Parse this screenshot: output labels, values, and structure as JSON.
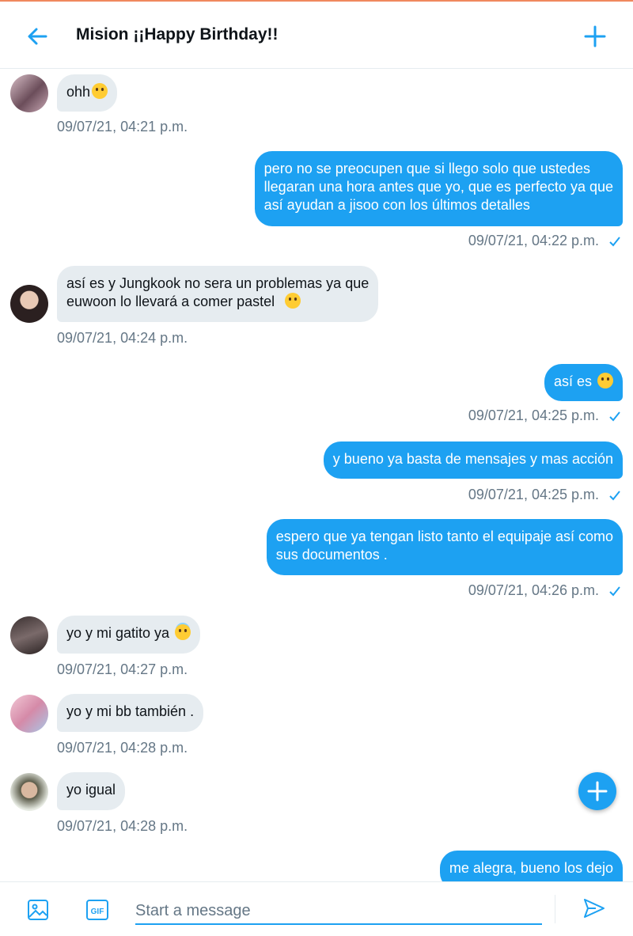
{
  "header": {
    "title": "Mision ¡¡Happy Birthday!!",
    "back_icon": "back-arrow-icon",
    "add_icon": "plus-icon"
  },
  "colors": {
    "accent": "#1da1f2",
    "incoming_bubble": "#e6ecf0",
    "timestamp": "#657786"
  },
  "messages": [
    {
      "id": 0,
      "direction": "in",
      "text": "ohh",
      "emoji": "face-emoji",
      "timestamp": "09/07/21, 04:21 p.m."
    },
    {
      "id": 1,
      "direction": "out",
      "lines": [
        "pero no se preocupen que si llego solo que ustedes",
        "llegaran una hora antes que yo, que es perfecto ya que",
        "así ayudan a jisoo con los últimos detalles"
      ],
      "timestamp": "09/07/21, 04:22 p.m."
    },
    {
      "id": 2,
      "direction": "in",
      "lines": [
        "así es y Jungkook no sera un problemas ya que",
        "euwoon lo llevará a comer pastel"
      ],
      "emoji": "grin-emoji",
      "timestamp": "09/07/21, 04:24 p.m."
    },
    {
      "id": 3,
      "direction": "out",
      "text": "así es",
      "emoji": "grin-emoji",
      "timestamp": "09/07/21, 04:25 p.m."
    },
    {
      "id": 4,
      "direction": "out",
      "text": "y bueno ya basta de mensajes y mas acción",
      "timestamp": "09/07/21, 04:25 p.m."
    },
    {
      "id": 5,
      "direction": "out",
      "lines": [
        "espero que ya tengan listo tanto el equipaje así como",
        "sus documentos ."
      ],
      "timestamp": "09/07/21, 04:26 p.m."
    },
    {
      "id": 6,
      "direction": "in",
      "text": "yo y mi gatito ya",
      "emoji": "halo-emoji",
      "timestamp": "09/07/21, 04:27 p.m."
    },
    {
      "id": 7,
      "direction": "in",
      "text": "yo y mi bb también .",
      "timestamp": "09/07/21, 04:28 p.m."
    },
    {
      "id": 8,
      "direction": "in",
      "text": "yo igual",
      "timestamp": "09/07/21, 04:28 p.m."
    },
    {
      "id": 9,
      "direction": "out",
      "text": "me alegra, bueno los dejo"
    }
  ],
  "composer": {
    "placeholder": "Start a message",
    "media_icon": "image-icon",
    "gif_icon": "gif-icon",
    "gif_label": "GIF",
    "send_icon": "send-icon"
  },
  "fab_icon": "plus-icon"
}
